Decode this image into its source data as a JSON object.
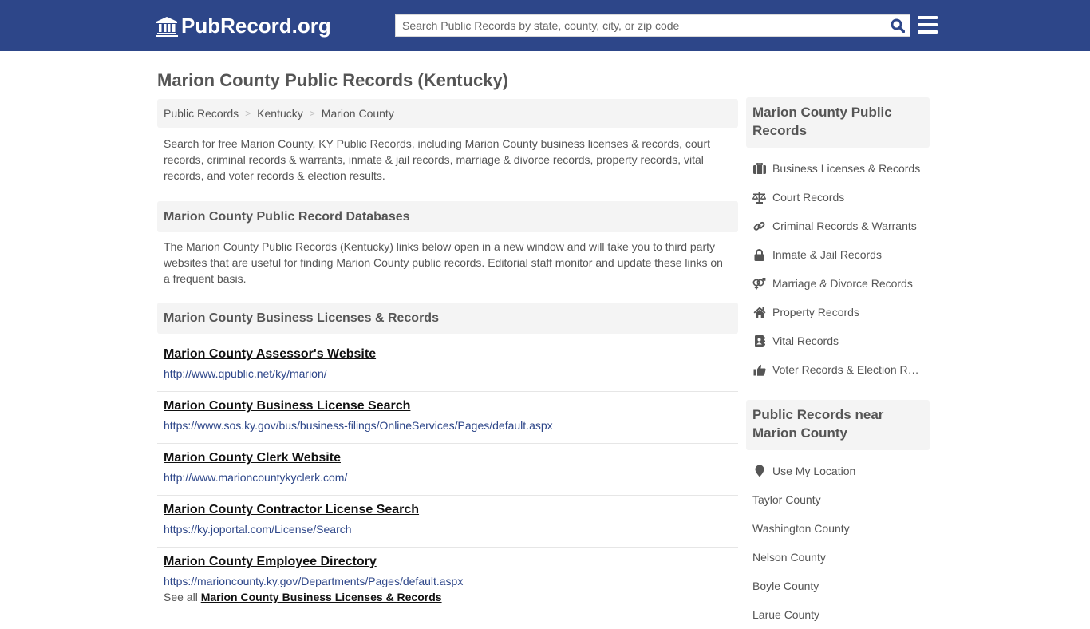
{
  "header": {
    "logo_text": "PubRecord.org",
    "search_placeholder": "Search Public Records by state, county, city, or zip code",
    "search_value": ""
  },
  "colors": {
    "brand_blue": "#2d4689",
    "panel_gray": "#f4f4f4",
    "text_gray": "#555555",
    "link_url_blue": "#2d4689"
  },
  "page_title": "Marion County Public Records (Kentucky)",
  "breadcrumb": [
    {
      "label": "Public Records"
    },
    {
      "label": "Kentucky"
    },
    {
      "label": "Marion County"
    }
  ],
  "breadcrumb_separator": ">",
  "intro": "Search for free Marion County, KY Public Records, including Marion County business licenses & records, court records, criminal records & warrants, inmate & jail records, marriage & divorce records, property records, vital records, and voter records & election results.",
  "databases": {
    "heading": "Marion County Public Record Databases",
    "description": "The Marion County Public Records (Kentucky) links below open in a new window and will take you to third party websites that are useful for finding Marion County public records. Editorial staff monitor and update these links on a frequent basis."
  },
  "business_section": {
    "heading": "Marion County Business Licenses & Records",
    "links": [
      {
        "title": "Marion County Assessor's Website",
        "url": "http://www.qpublic.net/ky/marion/"
      },
      {
        "title": "Marion County Business License Search",
        "url": "https://www.sos.ky.gov/bus/business-filings/OnlineServices/Pages/default.aspx"
      },
      {
        "title": "Marion County Clerk Website",
        "url": "http://www.marioncountykyclerk.com/"
      },
      {
        "title": "Marion County Contractor License Search",
        "url": "https://ky.joportal.com/License/Search"
      },
      {
        "title": "Marion County Employee Directory",
        "url": "https://marioncounty.ky.gov/Departments/Pages/default.aspx"
      }
    ],
    "see_all_prefix": "See all",
    "see_all_link": "Marion County Business Licenses & Records"
  },
  "sidebar": {
    "records_heading": "Marion County Public Records",
    "records_items": [
      {
        "label": "Business Licenses & Records",
        "icon": "briefcase-icon"
      },
      {
        "label": "Court Records",
        "icon": "balance-scale-icon"
      },
      {
        "label": "Criminal Records & Warrants",
        "icon": "link-icon"
      },
      {
        "label": "Inmate & Jail Records",
        "icon": "lock-icon"
      },
      {
        "label": "Marriage & Divorce Records",
        "icon": "venus-mars-icon"
      },
      {
        "label": "Property Records",
        "icon": "home-icon"
      },
      {
        "label": "Vital Records",
        "icon": "address-book-icon"
      },
      {
        "label": "Voter Records & Election Results",
        "icon": "thumbs-up-icon"
      }
    ],
    "near_heading": "Public Records near Marion County",
    "use_location": "Use My Location",
    "near_items": [
      {
        "label": "Taylor County"
      },
      {
        "label": "Washington County"
      },
      {
        "label": "Nelson County"
      },
      {
        "label": "Boyle County"
      },
      {
        "label": "Larue County"
      }
    ]
  }
}
